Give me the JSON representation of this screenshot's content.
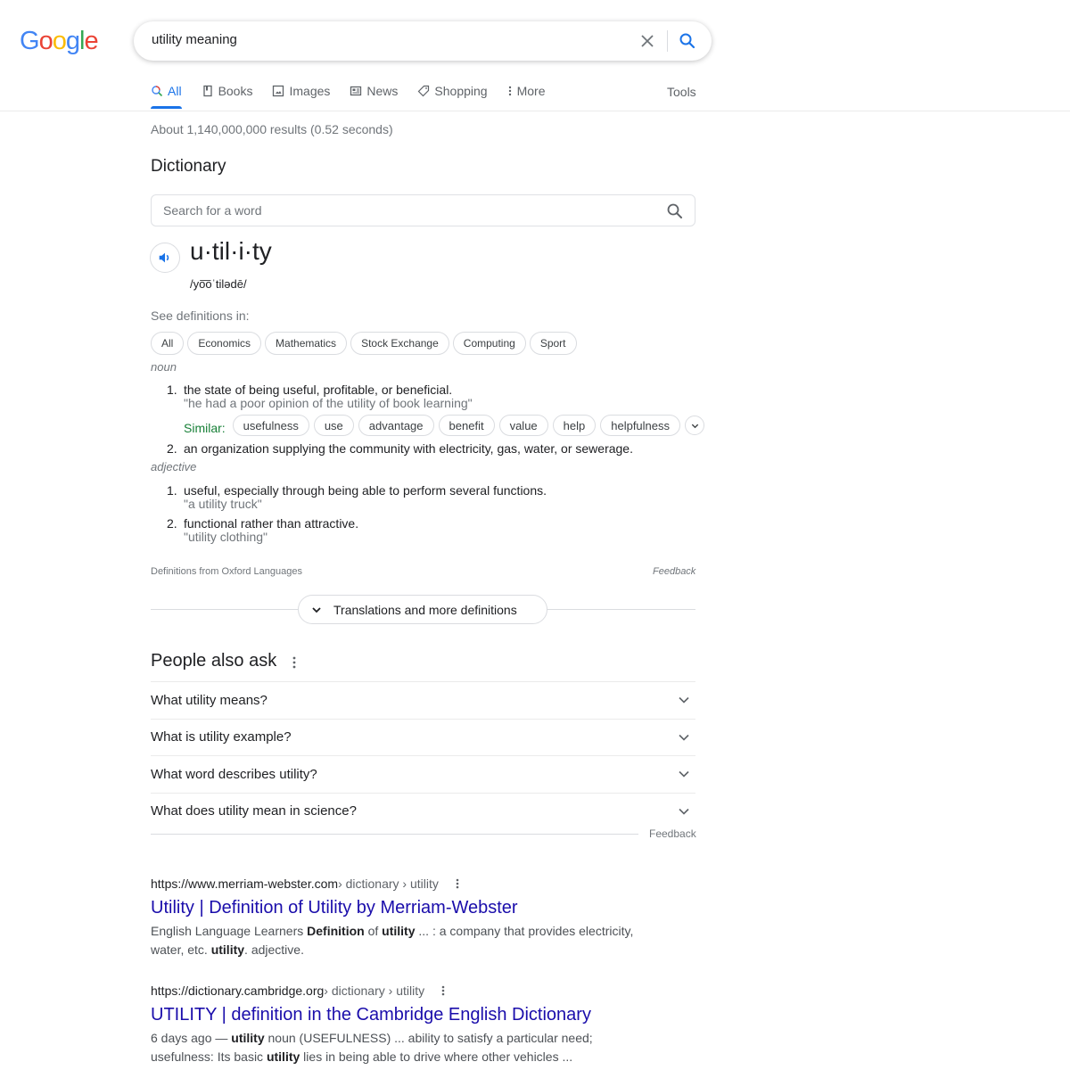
{
  "logo": {
    "letters": [
      "G",
      "o",
      "o",
      "g",
      "l",
      "e"
    ],
    "colors": [
      "#4285F4",
      "#EA4335",
      "#FBBC05",
      "#4285F4",
      "#34A853",
      "#EA4335"
    ]
  },
  "search": {
    "query": "utility meaning",
    "clear_icon": "close-icon",
    "submit_icon": "search-icon"
  },
  "tabs": [
    {
      "label": "All",
      "icon": "search-icon",
      "active": true
    },
    {
      "label": "Books",
      "icon": "book-icon"
    },
    {
      "label": "Images",
      "icon": "image-icon"
    },
    {
      "label": "News",
      "icon": "news-icon"
    },
    {
      "label": "Shopping",
      "icon": "tag-icon"
    },
    {
      "label": "More",
      "icon": "kebab-icon"
    }
  ],
  "tools_label": "Tools",
  "result_stats": "About 1,140,000,000 results (0.52 seconds)",
  "dictionary": {
    "title": "Dictionary",
    "search_placeholder": "Search for a word",
    "headword": "u·til·i·ty",
    "phonetic": "/yo͞oˈtilədē/",
    "see_definitions_label": "See definitions in:",
    "domains": [
      "All",
      "Economics",
      "Mathematics",
      "Stock Exchange",
      "Computing",
      "Sport"
    ],
    "noun": {
      "label": "noun",
      "defs": [
        {
          "num": "1.",
          "text": "the state of being useful, profitable, or beneficial.",
          "example": "\"he had a poor opinion of the utility of book learning\""
        },
        {
          "num": "2.",
          "text": "an organization supplying the community with electricity, gas, water, or sewerage."
        }
      ],
      "similar_label": "Similar:",
      "similar": [
        "usefulness",
        "use",
        "advantage",
        "benefit",
        "value",
        "help",
        "helpfulness"
      ]
    },
    "adjective": {
      "label": "adjective",
      "defs": [
        {
          "num": "1.",
          "text": "useful, especially through being able to perform several functions.",
          "example": "\"a utility truck\""
        },
        {
          "num": "2.",
          "text": "functional rather than attractive.",
          "example": "\"utility clothing\""
        }
      ]
    },
    "source": "Definitions from Oxford Languages",
    "feedback": "Feedback",
    "more_button": "Translations and more definitions"
  },
  "people_also_ask": {
    "title": "People also ask",
    "questions": [
      "What utility means?",
      "What is utility example?",
      "What word describes utility?",
      "What does utility mean in science?"
    ],
    "feedback": "Feedback"
  },
  "results": [
    {
      "url": "https://www.merriam-webster.com",
      "crumbs": " › dictionary › utility",
      "title": "Utility | Definition of Utility by Merriam-Webster",
      "snippet_parts": [
        {
          "t": "English Language Learners "
        },
        {
          "t": "Definition",
          "b": true
        },
        {
          "t": " of "
        },
        {
          "t": "utility",
          "b": true
        },
        {
          "t": " ... : a company that provides electricity, water, etc. "
        },
        {
          "t": "utility",
          "b": true
        },
        {
          "t": ". adjective."
        }
      ]
    },
    {
      "url": "https://dictionary.cambridge.org",
      "crumbs": " › dictionary › utility",
      "title": "UTILITY | definition in the Cambridge English Dictionary",
      "snippet_parts": [
        {
          "t": "6 days ago — "
        },
        {
          "t": "utility",
          "b": true
        },
        {
          "t": " noun (USEFULNESS) ... ability to satisfy a particular need; usefulness: Its basic "
        },
        {
          "t": "utility",
          "b": true
        },
        {
          "t": " lies in being able to drive where other vehicles ..."
        }
      ]
    }
  ]
}
